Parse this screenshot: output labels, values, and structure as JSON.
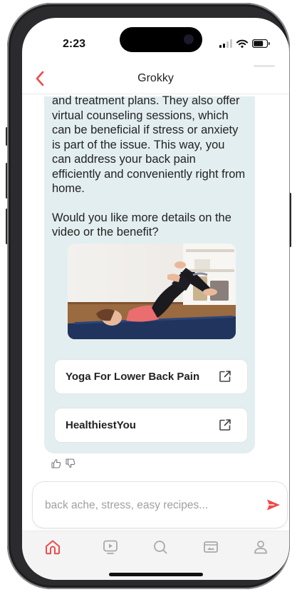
{
  "status_bar": {
    "time": "2:23"
  },
  "nav": {
    "title": "Grokky"
  },
  "message": {
    "paragraph_1": "and treatment plans. They also offer virtual counseling sessions, which can be beneficial if stress or anxiety is part of the issue. This way, you can address your back pain efficiently and conveniently right from home.",
    "paragraph_2": "Would you like more details on the video or the benefit?"
  },
  "links": [
    {
      "label": "Yoga For Lower Back Pain",
      "icon": "external-link-icon"
    },
    {
      "label": "HealthiestYou",
      "icon": "external-link-icon"
    }
  ],
  "input": {
    "placeholder": "back ache, stress, easy recipes...",
    "value": ""
  },
  "tabs": [
    {
      "icon": "home-icon",
      "active": true
    },
    {
      "icon": "video-icon",
      "active": false
    },
    {
      "icon": "search-icon",
      "active": false
    },
    {
      "icon": "media-icon",
      "active": false
    },
    {
      "icon": "profile-icon",
      "active": false
    }
  ],
  "colors": {
    "accent": "#f04a4a",
    "bubble": "#e3eef0",
    "tab_inactive": "#a9a9a9"
  }
}
